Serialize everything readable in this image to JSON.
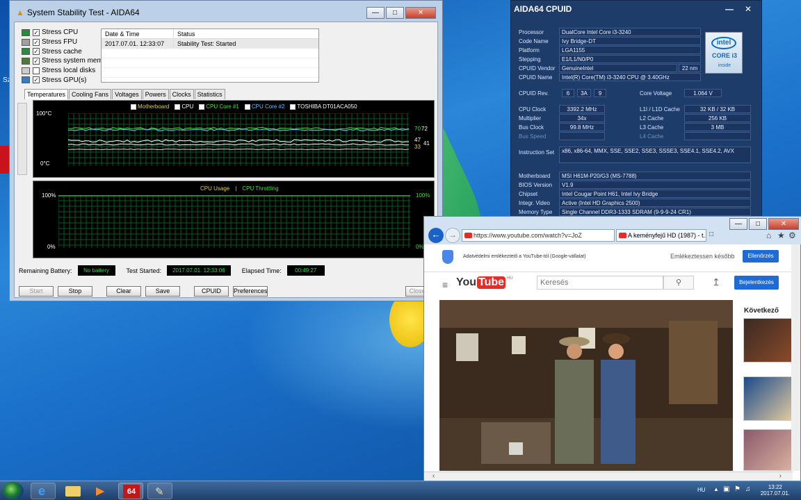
{
  "desktop": {
    "icon_label": "Sz"
  },
  "aida": {
    "title": "System Stability Test - AIDA64",
    "stress": [
      {
        "label": "Stress CPU",
        "checked": true
      },
      {
        "label": "Stress FPU",
        "checked": true
      },
      {
        "label": "Stress cache",
        "checked": true
      },
      {
        "label": "Stress system memory",
        "checked": true
      },
      {
        "label": "Stress local disks",
        "checked": false
      },
      {
        "label": "Stress GPU(s)",
        "checked": true
      }
    ],
    "log": {
      "col1": "Date & Time",
      "col2": "Status",
      "row_time": "2017.07.01. 12:33:07",
      "row_status": "Stability Test: Started"
    },
    "tabs": [
      "Temperatures",
      "Cooling Fans",
      "Voltages",
      "Powers",
      "Clocks",
      "Statistics"
    ],
    "temp_graph": {
      "legend": [
        "Motherboard",
        "CPU",
        "CPU Core #1",
        "CPU Core #2",
        "TOSHIBA DT01ACA050"
      ],
      "legend_colors": [
        "#e0d060",
        "#ffffff",
        "#40e040",
        "#60c0ff",
        "#ffffff"
      ],
      "y_top": "100°C",
      "y_bottom": "0°C",
      "values": [
        "70",
        "72",
        "47",
        "41",
        "33"
      ]
    },
    "usage_graph": {
      "legend1": "CPU Usage",
      "sep": "|",
      "legend2": "CPU Throttling",
      "y_top_left": "100%",
      "y_bottom_left": "0%",
      "y_top_right": "100%",
      "y_bottom_right": "0%"
    },
    "status": {
      "battery_label": "Remaining Battery:",
      "battery_value": "No battery",
      "started_label": "Test Started:",
      "started_value": "2017.07.01. 12:33:06",
      "elapsed_label": "Elapsed Time:",
      "elapsed_value": "00:49:27"
    },
    "buttons": {
      "start": "Start",
      "stop": "Stop",
      "clear": "Clear",
      "save": "Save",
      "cpuid": "CPUID",
      "preferences": "Preferences",
      "close": "Close"
    }
  },
  "cpuid": {
    "title": "AIDA64 CPUID",
    "processor": "DualCore Intel Core i3-3240",
    "code_name": "Ivy Bridge-DT",
    "platform": "LGA1155",
    "stepping": "E1/L1/N0/P0",
    "vendor": "GenuineIntel",
    "nm": "22 nm",
    "cpuid_name": "Intel(R) Core(TM) i3-3240 CPU @ 3.40GHz",
    "rev1": "6",
    "rev2": "3A",
    "rev3": "9",
    "core_voltage": "1.064 V",
    "cpu_clock": "3392.2 MHz",
    "l1": "32 KB / 32 KB",
    "multiplier": "34x",
    "l2": "256 KB",
    "bus_clock": "99.8 MHz",
    "l3": "3 MB",
    "instruction_set": "x86, x86-64, MMX, SSE, SSE2, SSE3, SSSE3, SSE4.1, SSE4.2, AVX",
    "motherboard": "MSI H61M-P20/G3 (MS-7788)",
    "bios": "V1.9",
    "chipset": "Intel Cougar Point H61, Intel Ivy Bridge",
    "video": "Active  (Intel HD Graphics 2500)",
    "memory": "Single Channel DDR3-1333 SDRAM  (9-9-9-24 CR1)",
    "labels": {
      "processor": "Processor",
      "code_name": "Code Name",
      "platform": "Platform",
      "stepping": "Stepping",
      "vendor": "CPUID Vendor",
      "cpuid_name": "CPUID Name",
      "rev": "CPUID Rev.",
      "core_voltage": "Core Voltage",
      "cpu_clock": "CPU Clock",
      "l1": "L1I / L1D Cache",
      "multiplier": "Multiplier",
      "l2": "L2 Cache",
      "bus_clock": "Bus Clock",
      "l3": "L3 Cache",
      "bus_speed": "Bus Speed",
      "l4": "L4 Cache",
      "instruction_set": "Instruction Set",
      "motherboard": "Motherboard",
      "bios": "BIOS Version",
      "chipset": "Chipset",
      "video": "Integr. Video",
      "memory": "Memory Type"
    },
    "badge": {
      "brand": "intel",
      "line": "CORE i3",
      "inside": "inside"
    }
  },
  "browser": {
    "url": "https://www.youtube.com/watch?v=JoZ",
    "tab_title": "A keményfejű HD (1987) - t...",
    "consent_text": "Adatvédelmi emlékeztető a YouTube-tól (Google-vállalat)",
    "remind_later": "Emlékeztessen később",
    "review": "Ellenőrzés",
    "search_placeholder": "Keresés",
    "login": "Bejelentkezés",
    "logo_you": "You",
    "logo_tube": "Tube",
    "logo_hu": "HU",
    "next": "Következő"
  },
  "taskbar": {
    "lang": "HU",
    "time": "13:22",
    "date": "2017.07.01.",
    "aida_label": "64"
  }
}
